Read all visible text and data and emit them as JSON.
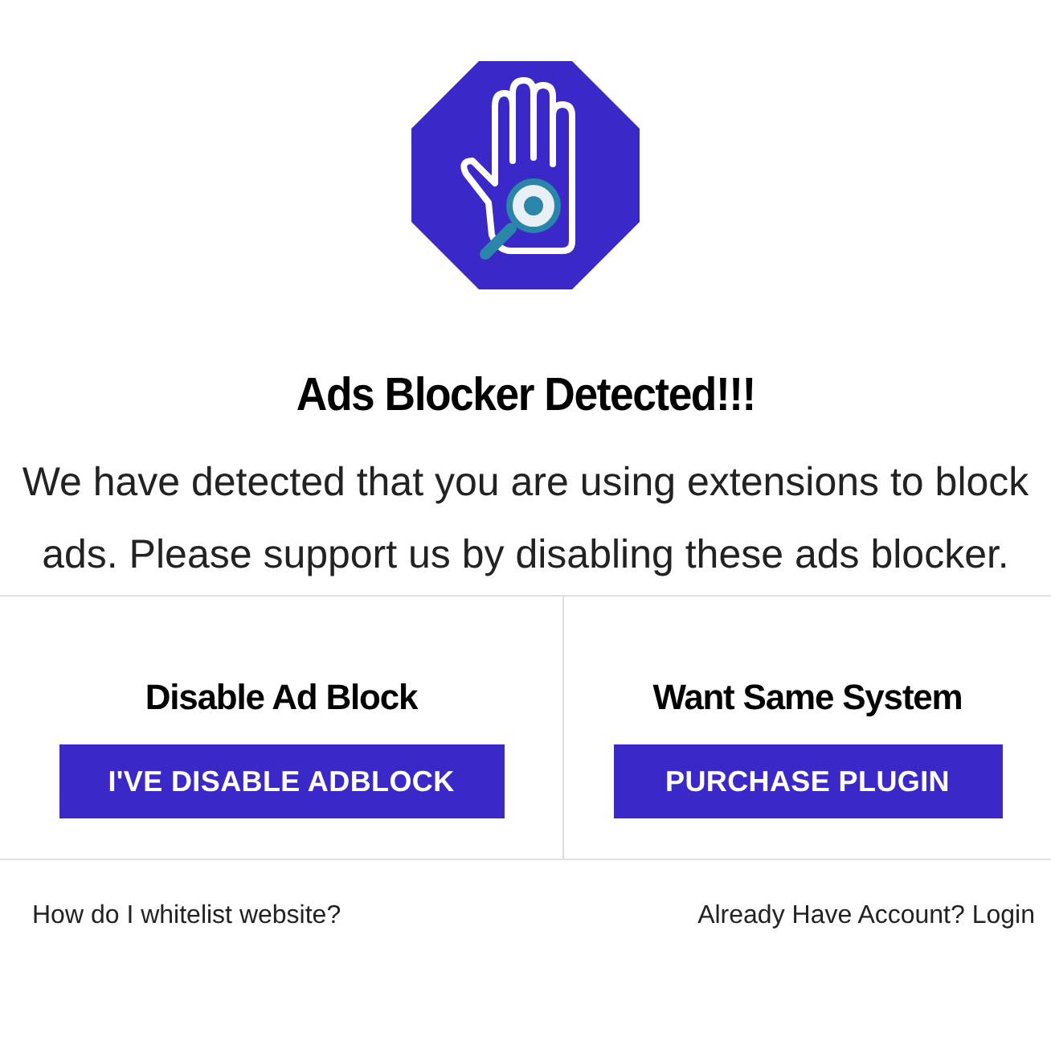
{
  "title": "Ads Blocker Detected!!!",
  "message": "We have detected that you are using extensions to block ads. Please support us by disabling these ads blocker.",
  "options": [
    {
      "heading": "Disable Ad Block",
      "button": "I'VE DISABLE ADBLOCK"
    },
    {
      "heading": "Want Same System",
      "button": "PURCHASE PLUGIN"
    }
  ],
  "footer_links": [
    "How do I whitelist website?",
    "Already Have Account? Login"
  ]
}
